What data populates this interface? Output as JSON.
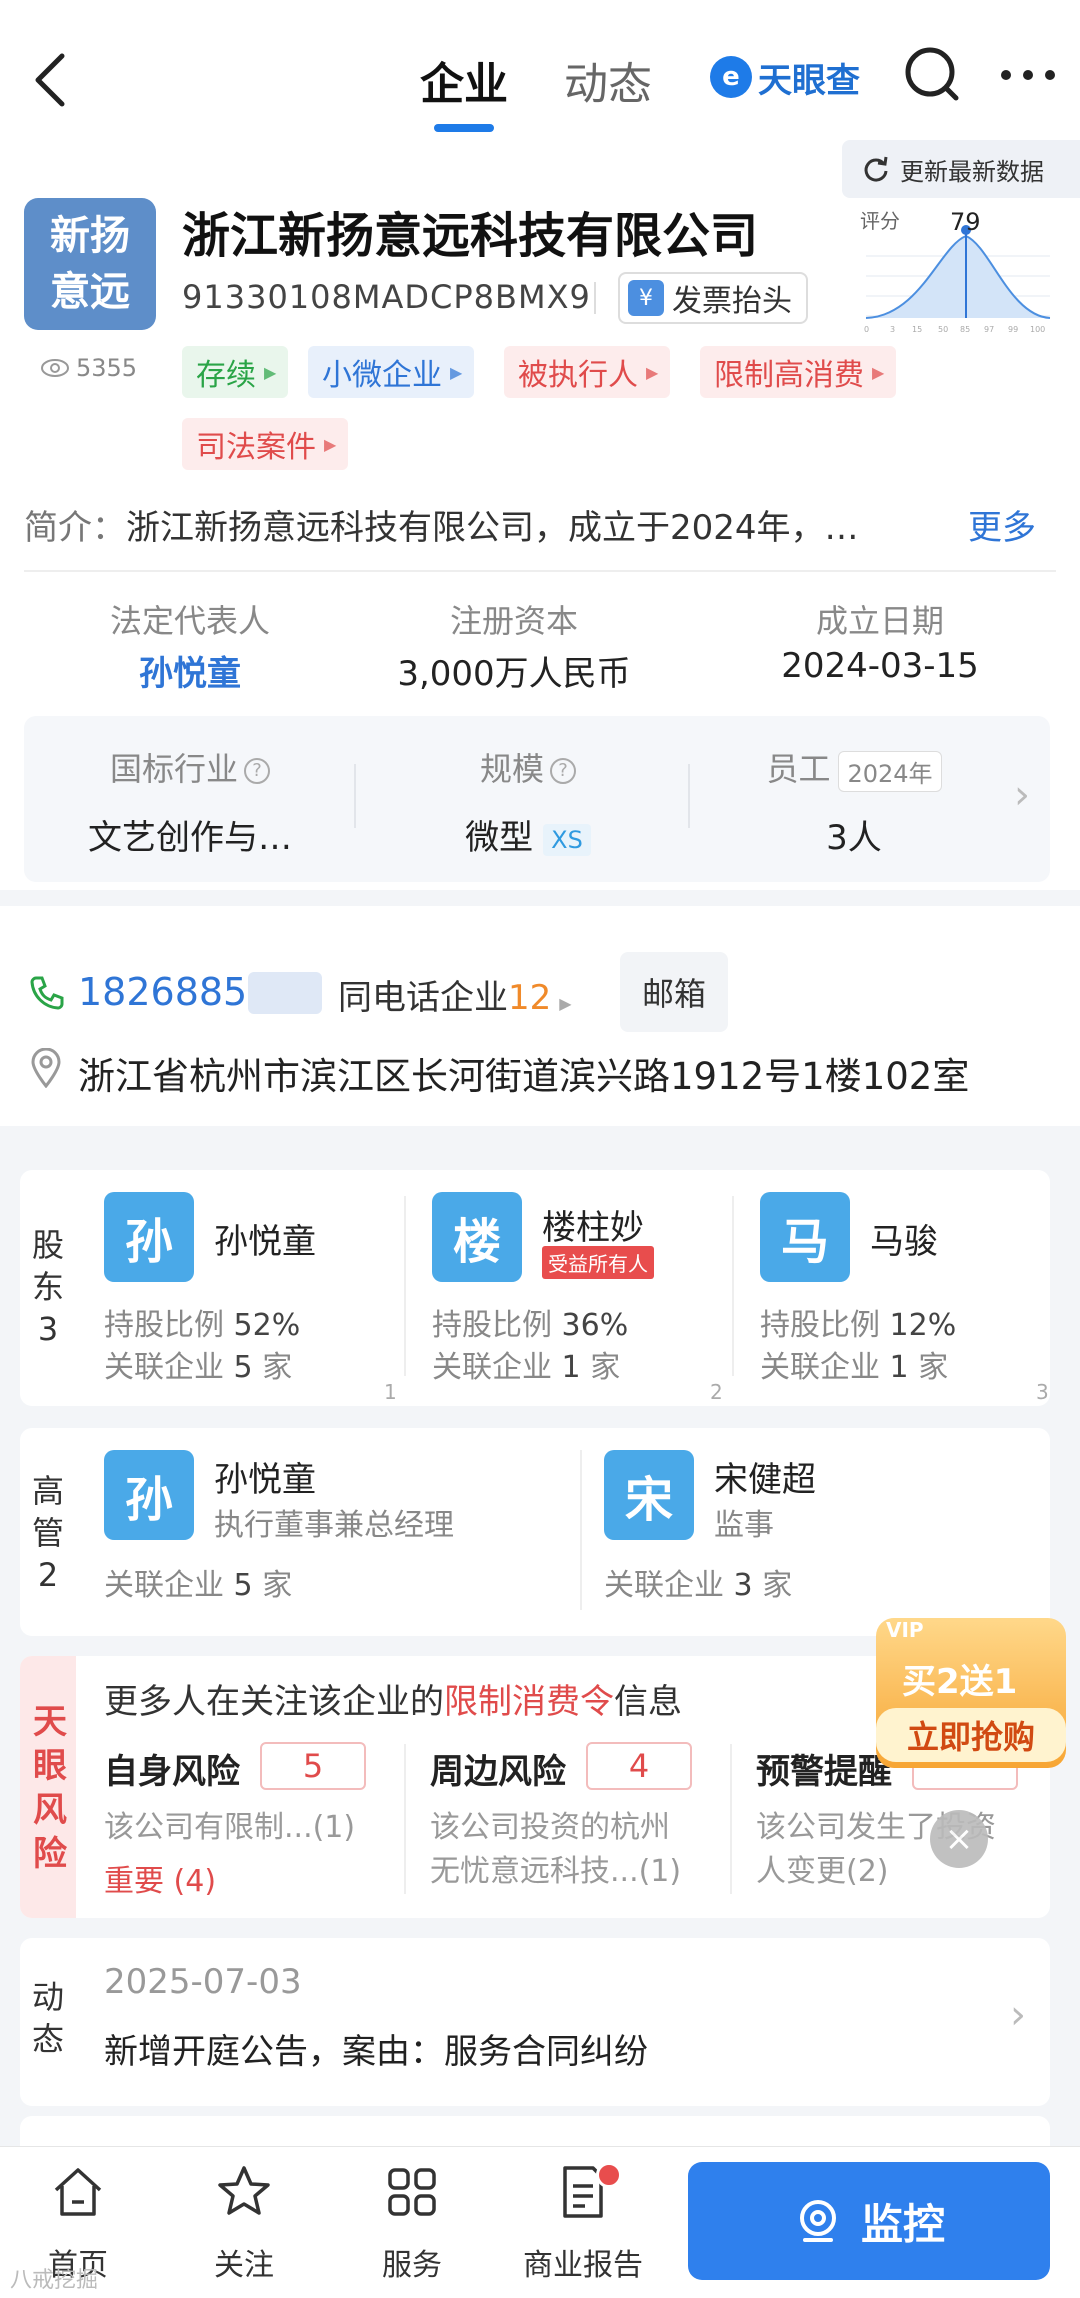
{
  "topbar": {
    "tabs": [
      {
        "label": "企业",
        "active": true
      },
      {
        "label": "动态",
        "active": false
      }
    ],
    "brand": "天眼查",
    "brand_mark": "e"
  },
  "header": {
    "update_label": "更新最新数据",
    "logo_text": [
      "新扬",
      "意远"
    ],
    "company_name": "浙江新扬意远科技有限公司",
    "credit_code": "91330108MADCP8BMX9",
    "invoice_label": "发票抬头",
    "invoice_icon": "¥",
    "views": "5355",
    "score_label": "评分",
    "score_value": "79",
    "score_axis": [
      "0",
      "3",
      "15",
      "50",
      "85",
      "97",
      "99",
      "100"
    ],
    "tags": [
      {
        "label": "存续",
        "color": "green"
      },
      {
        "label": "小微企业",
        "color": "blue"
      },
      {
        "label": "被执行人",
        "color": "red"
      },
      {
        "label": "限制高消费",
        "color": "red"
      },
      {
        "label": "司法案件",
        "color": "red"
      }
    ],
    "intro_label": "简介：",
    "intro_text": "浙江新扬意远科技有限公司，成立于2024年，…",
    "intro_more": "更多",
    "legal_rep_label": "法定代表人",
    "legal_rep": "孙悦童",
    "capital_label": "注册资本",
    "capital": "3,000万人民币",
    "founded_label": "成立日期",
    "founded": "2024-03-15",
    "industry_label": "国标行业",
    "industry": "文艺创作与…",
    "scale_label": "规模",
    "scale": "微型",
    "scale_badge": "XS",
    "staff_label": "员工",
    "staff_year": "2024年",
    "staff": "3人"
  },
  "contact": {
    "phone": "1826885",
    "same_phone_label": "同电话企业",
    "same_phone_count": "12",
    "email_label": "邮箱",
    "address": "浙江省杭州市滨江区长河街道滨兴路1912号1楼102室"
  },
  "shareholders": {
    "side_label": [
      "股",
      "东",
      "3"
    ],
    "items": [
      {
        "avatar": "孙",
        "name": "孙悦童",
        "badge": "",
        "ratio_label": "持股比例",
        "ratio": "52%",
        "related_label": "关联企业",
        "related": "5",
        "unit": "家",
        "index": "1"
      },
      {
        "avatar": "楼",
        "name": "楼柱妙",
        "badge": "受益所有人",
        "ratio_label": "持股比例",
        "ratio": "36%",
        "related_label": "关联企业",
        "related": "1",
        "unit": "家",
        "index": "2"
      },
      {
        "avatar": "马",
        "name": "马骏",
        "badge": "",
        "ratio_label": "持股比例",
        "ratio": "12%",
        "related_label": "关联企业",
        "related": "1",
        "unit": "家",
        "index": "3"
      }
    ]
  },
  "executives": {
    "side_label": [
      "高",
      "管",
      "2"
    ],
    "items": [
      {
        "avatar": "孙",
        "name": "孙悦童",
        "role": "执行董事兼总经理",
        "related_label": "关联企业",
        "related": "5",
        "unit": "家"
      },
      {
        "avatar": "宋",
        "name": "宋健超",
        "role": "监事",
        "related_label": "关联企业",
        "related": "3",
        "unit": "家"
      }
    ]
  },
  "risk": {
    "side_label": [
      "天",
      "眼",
      "风",
      "险"
    ],
    "title_prefix": "更多人在关注该企业的",
    "title_highlight": "限制消费令",
    "title_suffix": "信息",
    "items": [
      {
        "name": "自身风险",
        "count": "5",
        "desc1": "该公司有限制...(1)",
        "desc2": "重要 (4)"
      },
      {
        "name": "周边风险",
        "count": "4",
        "desc1": "该公司投资的杭州",
        "desc2": "无忧意远科技...(1)"
      },
      {
        "name": "预警提醒",
        "count": "",
        "desc1": "该公司发生了投资",
        "desc2": "人变更(2)"
      }
    ]
  },
  "promo": {
    "vip": "VIP",
    "line1": "买2送1",
    "line2": "立即抢购",
    "close": "×"
  },
  "dynamics": {
    "side_label": [
      "动",
      "态"
    ],
    "date": "2025-07-03",
    "text": "新增开庭公告，案由：服务合同纠纷"
  },
  "bottom_nav": {
    "items": [
      {
        "label": "首页",
        "icon": "home-icon"
      },
      {
        "label": "关注",
        "icon": "star-icon"
      },
      {
        "label": "服务",
        "icon": "grid-icon"
      },
      {
        "label": "商业报告",
        "icon": "report-icon"
      }
    ],
    "monitor_label": "监控"
  },
  "watermark": "八戒挖掘"
}
